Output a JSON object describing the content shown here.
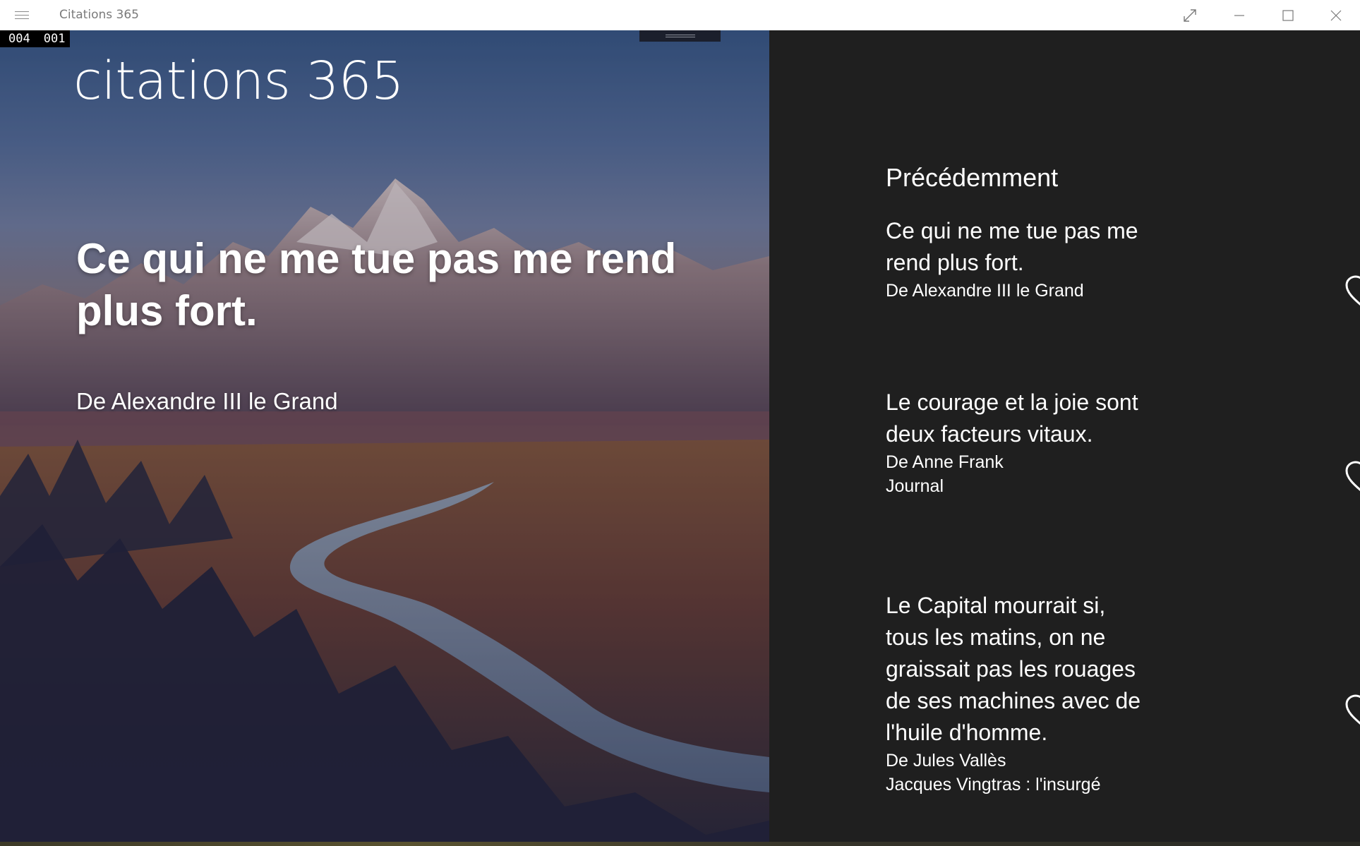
{
  "window": {
    "title": "Citations 365",
    "menu_icon": "hamburger-icon",
    "controls": [
      "fullscreen-icon",
      "minimize-icon",
      "maximize-icon",
      "close-icon"
    ]
  },
  "counter": {
    "first": "004",
    "second": "001"
  },
  "hero": {
    "app_name": "citations 365",
    "quote": "Ce qui ne me tue pas me rend plus fort.",
    "author": "De Alexandre III le Grand"
  },
  "history": {
    "heading": "Précédemment",
    "items": [
      {
        "quote": "Ce qui ne me tue pas me rend plus fort.",
        "author": "De Alexandre III le Grand",
        "source": "",
        "favorite_icon": "heart-outline-icon"
      },
      {
        "quote": "Le courage et la joie sont deux facteurs vitaux.",
        "author": "De Anne Frank",
        "source": "Journal",
        "favorite_icon": "heart-outline-icon"
      },
      {
        "quote": "Le Capital mourrait si, tous les matins, on ne graissait pas les rouages de ses machines avec de l'huile d'homme.",
        "author": "De Jules Vallès",
        "source": "Jacques Vingtras : l'insurgé",
        "favorite_icon": "heart-outline-icon"
      }
    ]
  },
  "colors": {
    "titlebar": "#ffffff",
    "side_panel": "#1f1f1f",
    "text": "#ffffff"
  }
}
